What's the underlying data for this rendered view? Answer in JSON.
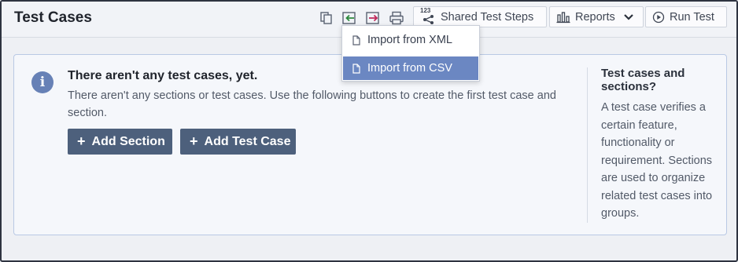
{
  "header": {
    "title": "Test Cases",
    "shared_steps_badge": "123",
    "shared_steps_label": "Shared Test Steps",
    "reports_label": "Reports",
    "run_test_label": "Run Test"
  },
  "import_menu": {
    "items": [
      {
        "label": "Import from XML",
        "icon": "file-icon"
      },
      {
        "label": "Import from CSV",
        "icon": "file-icon"
      }
    ]
  },
  "empty_state": {
    "title": "There aren't any test cases, yet.",
    "description": "There aren't any sections or test cases. Use the following buttons to create the first test case and section.",
    "add_section_label": "Add Section",
    "add_test_case_label": "Add Test Case"
  },
  "help": {
    "title": "Test cases and sections?",
    "text": "A test case verifies a certain feature, functionality or requirement. Sections are used to organize related test cases into groups."
  },
  "colors": {
    "accent": "#4d607c",
    "menu_highlight": "#6b87c2",
    "info_icon": "#6781b6",
    "import_icon_green": "#2e8a3e",
    "export_icon_red": "#c0285a"
  }
}
